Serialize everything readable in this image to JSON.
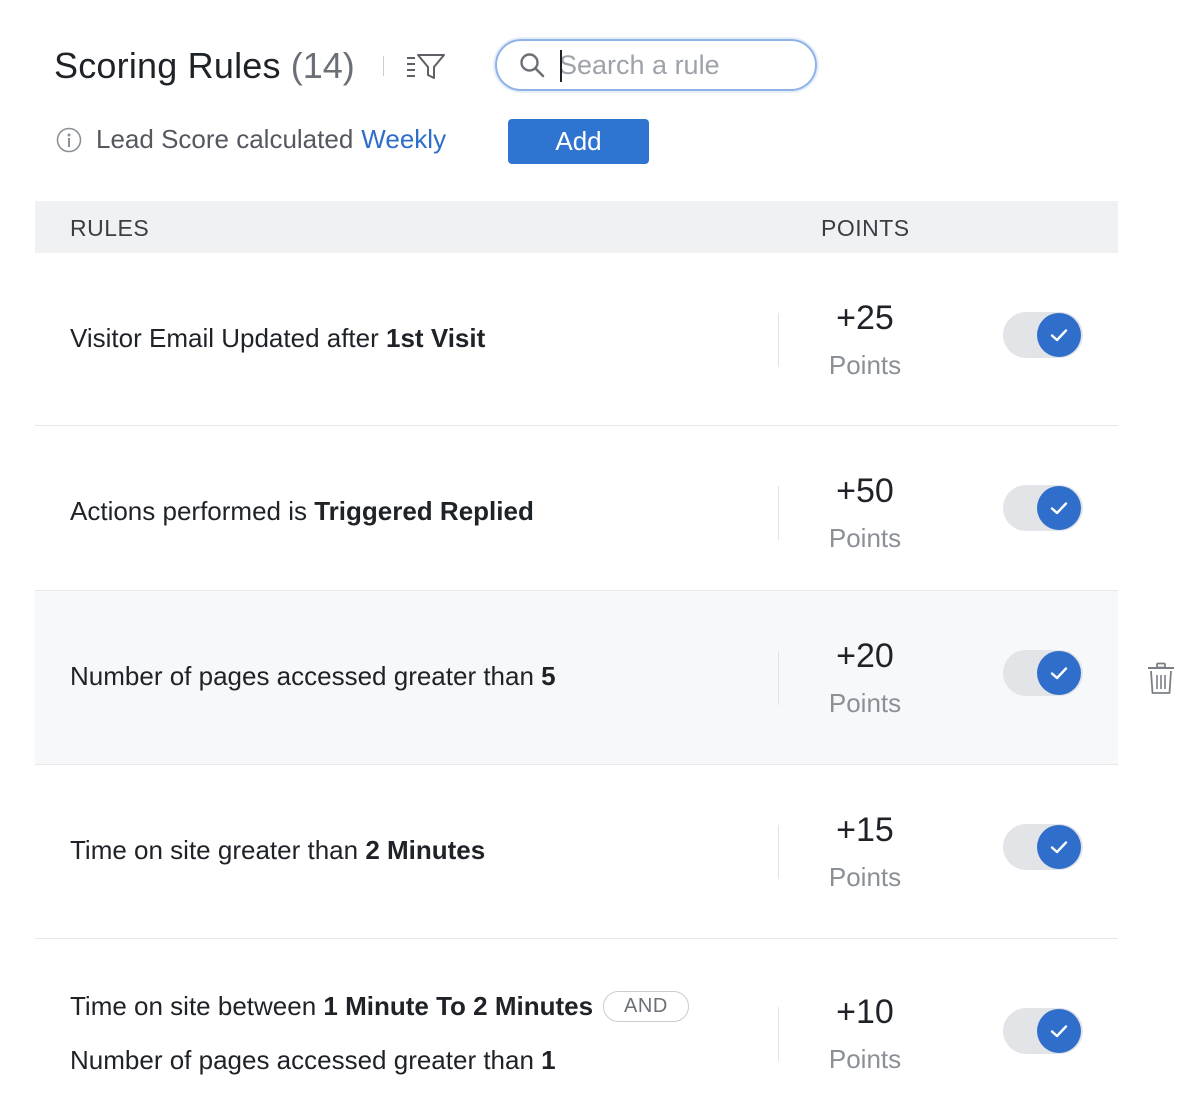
{
  "header": {
    "title": "Scoring Rules",
    "count": "(14)"
  },
  "search": {
    "placeholder": "Search a rule",
    "value": ""
  },
  "info": {
    "prefix": "Lead Score calculated",
    "frequency": "Weekly"
  },
  "add_label": "Add",
  "table": {
    "col_rules": "RULES",
    "col_points": "POINTS"
  },
  "rows": [
    {
      "text": "Visitor Email Updated after",
      "bold": "1st Visit",
      "points": "+25",
      "points_label": "Points",
      "enabled": true
    },
    {
      "text": "Actions performed is",
      "bold": "Triggered Replied",
      "points": "+50",
      "points_label": "Points",
      "enabled": true
    },
    {
      "text": "Number of pages accessed greater than",
      "bold": "5",
      "points": "+20",
      "points_label": "Points",
      "enabled": true
    },
    {
      "text": "Time on site greater than",
      "bold": "2 Minutes",
      "points": "+15",
      "points_label": "Points",
      "enabled": true
    },
    {
      "text": "Time on site between",
      "bold": "1 Minute To 2 Minutes",
      "connector": "AND",
      "text2": "Number of pages accessed greater than",
      "bold2": "1",
      "points": "+10",
      "points_label": "Points",
      "enabled": true
    }
  ],
  "icons": {
    "search": "search-icon",
    "filter": "filter-icon",
    "info": "info-icon",
    "check": "check-icon",
    "trash": "trash-icon"
  },
  "colors": {
    "accent": "#2f74d0",
    "toggle_on": "#2f6fcb",
    "link": "#2d6dcc"
  }
}
